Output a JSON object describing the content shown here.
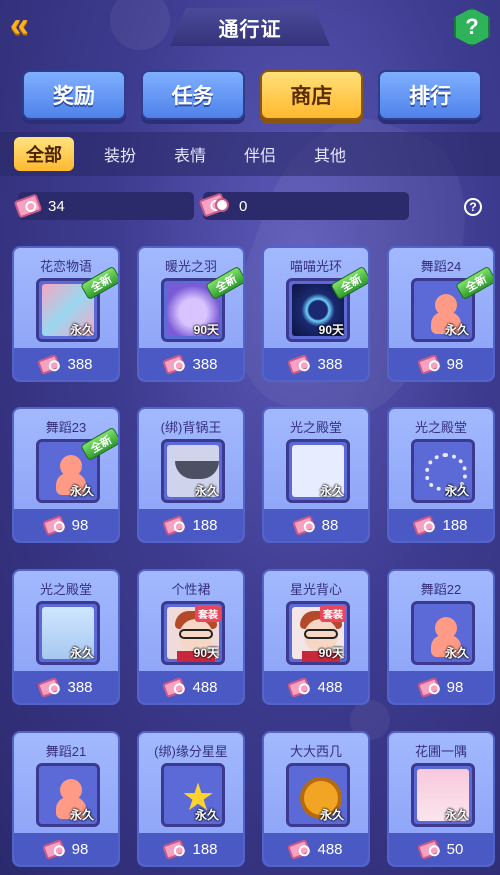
{
  "header": {
    "title": "通行证",
    "back_icon": "double-chevron-left-icon",
    "help_icon": "question-hex-icon"
  },
  "main_tabs": [
    {
      "label": "奖励",
      "active": false
    },
    {
      "label": "任务",
      "active": false
    },
    {
      "label": "商店",
      "active": true
    },
    {
      "label": "排行",
      "active": false
    }
  ],
  "sub_tabs": [
    {
      "label": "全部",
      "active": true
    },
    {
      "label": "装扮",
      "active": false
    },
    {
      "label": "表情",
      "active": false
    },
    {
      "label": "伴侣",
      "active": false
    },
    {
      "label": "其他",
      "active": false
    }
  ],
  "currency": {
    "tickets": "34",
    "timed_tickets": "0",
    "help": "?"
  },
  "items": [
    {
      "name": "花恋物语",
      "duration": "永久",
      "price": "388",
      "badge": "全新",
      "art": "flower"
    },
    {
      "name": "暖光之羽",
      "duration": "90天",
      "price": "388",
      "badge": "全新",
      "art": "wing"
    },
    {
      "name": "喵喵光环",
      "duration": "90天",
      "price": "388",
      "badge": "全新",
      "art": "halo"
    },
    {
      "name": "舞蹈24",
      "duration": "永久",
      "price": "98",
      "badge": "全新",
      "art": "dancer"
    },
    {
      "name": "舞蹈23",
      "duration": "永久",
      "price": "98",
      "badge": "全新",
      "art": "dancer"
    },
    {
      "name": "(绑)背锅王",
      "duration": "永久",
      "price": "188",
      "badge": "",
      "art": "pot"
    },
    {
      "name": "光之殿堂",
      "duration": "永久",
      "price": "88",
      "badge": "",
      "art": "palace"
    },
    {
      "name": "光之殿堂",
      "duration": "永久",
      "price": "188",
      "badge": "",
      "art": "hearts"
    },
    {
      "name": "光之殿堂",
      "duration": "永久",
      "price": "388",
      "badge": "",
      "art": "blue"
    },
    {
      "name": "个性裙",
      "duration": "90天",
      "price": "488",
      "badge": "套装",
      "art": "girl"
    },
    {
      "name": "星光背心",
      "duration": "90天",
      "price": "488",
      "badge": "套装",
      "art": "girl2"
    },
    {
      "name": "舞蹈22",
      "duration": "永久",
      "price": "98",
      "badge": "",
      "art": "dancer"
    },
    {
      "name": "舞蹈21",
      "duration": "永久",
      "price": "98",
      "badge": "",
      "art": "dancer"
    },
    {
      "name": "(绑)缘分星星",
      "duration": "永久",
      "price": "188",
      "badge": "",
      "art": "star"
    },
    {
      "name": "大大西几",
      "duration": "永久",
      "price": "488",
      "badge": "",
      "art": "lion"
    },
    {
      "name": "花圃一隅",
      "duration": "永久",
      "price": "50",
      "badge": "",
      "art": "garden"
    }
  ]
}
